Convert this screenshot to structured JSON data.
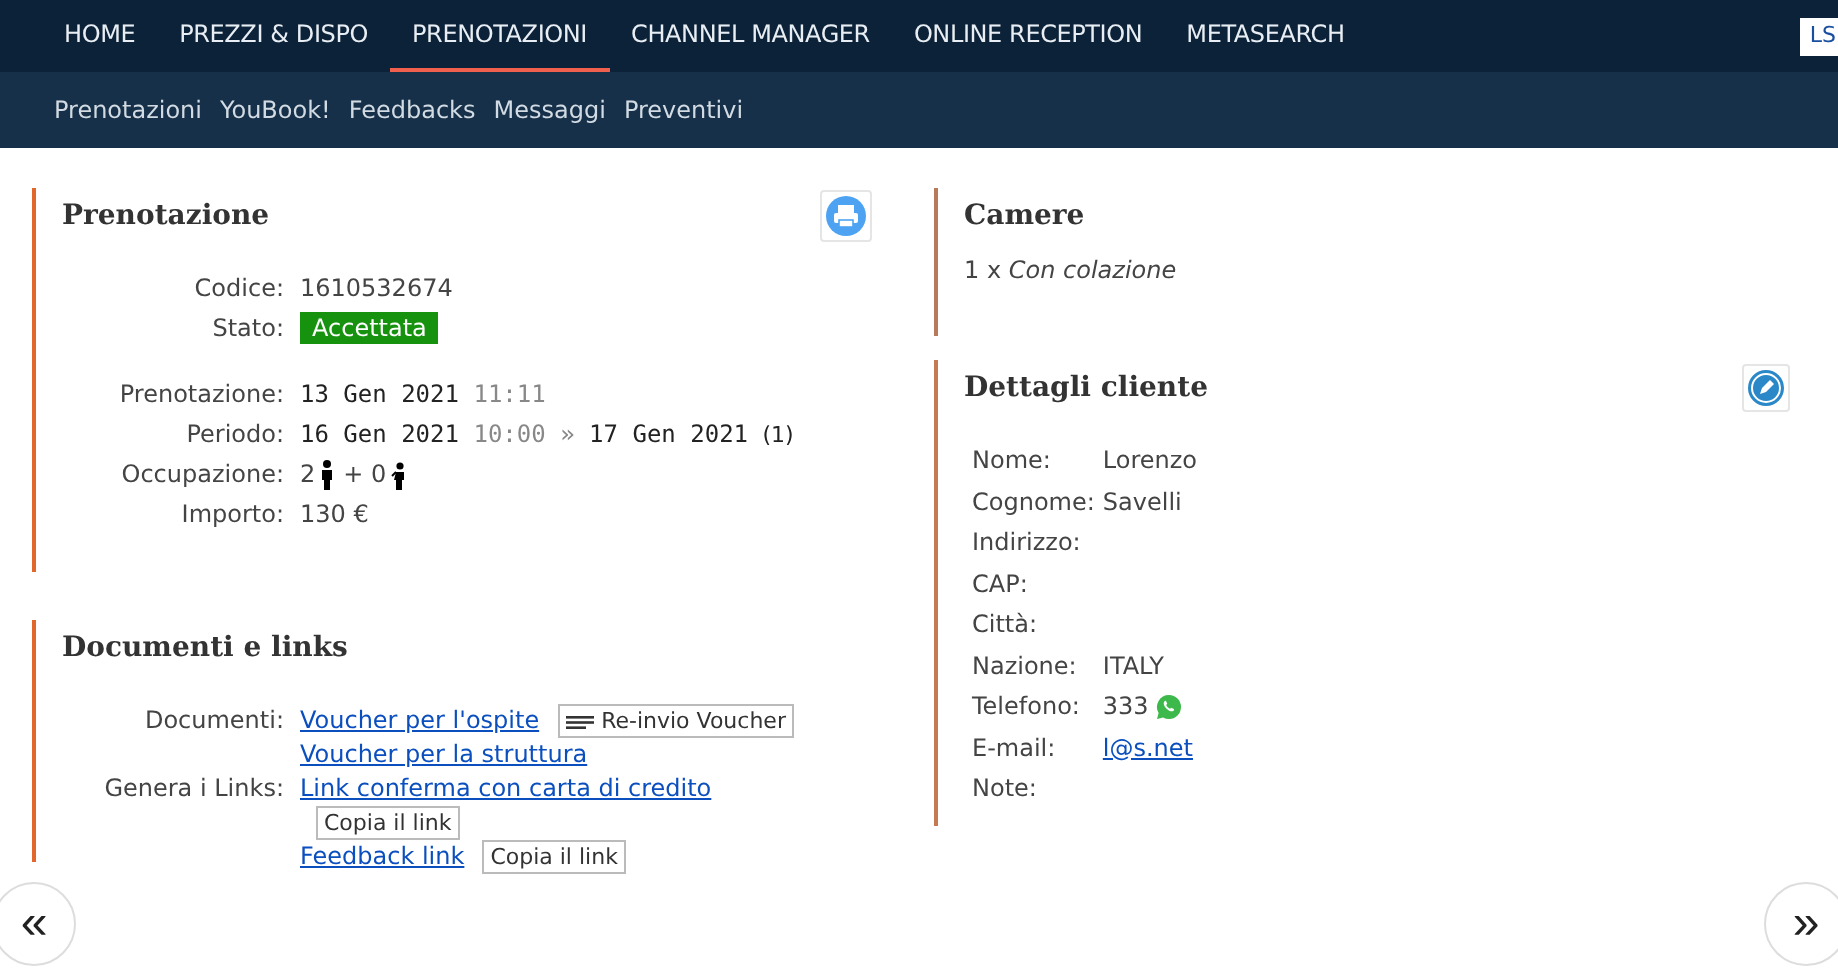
{
  "nav": [
    {
      "label": "HOME",
      "selected": false
    },
    {
      "label": "PREZZI & DISPO",
      "selected": false
    },
    {
      "label": "PRENOTAZIONI",
      "selected": true
    },
    {
      "label": "CHANNEL MANAGER",
      "selected": false
    },
    {
      "label": "ONLINE RECEPTION",
      "selected": false
    },
    {
      "label": "METASEARCH",
      "selected": false
    }
  ],
  "user_badge": "LS",
  "subnav": [
    "Prenotazioni",
    "YouBook!",
    "Feedbacks",
    "Messaggi",
    "Preventivi"
  ],
  "booking": {
    "title": "Prenotazione",
    "code_label": "Codice:",
    "code": "1610532674",
    "status_label": "Stato:",
    "status": "Accettata",
    "created_label": "Prenotazione:",
    "created_date": "13 Gen 2021",
    "created_time": "11:11",
    "period_label": "Periodo:",
    "period_from": "16 Gen 2021",
    "period_time": "10:00",
    "period_sep": "»",
    "period_to": "17 Gen 2021",
    "nights": "(1)",
    "occupancy_label": "Occupazione:",
    "adults": "2",
    "children": "+ 0",
    "amount_label": "Importo:",
    "amount": "130 €"
  },
  "documents": {
    "title": "Documenti e links",
    "docs_label": "Documenti:",
    "guest_voucher": "Voucher per l'ospite",
    "resend_button": "Re-invio Voucher",
    "property_voucher": "Voucher per la struttura",
    "links_label": "Genera i Links:",
    "card_link": "Link conferma con carta di credito",
    "copy_button_1": "Copia il link",
    "feedback_link": "Feedback link",
    "copy_button_2": "Copia il link"
  },
  "rooms": {
    "title": "Camere",
    "count": "1 x",
    "name": "Con colazione"
  },
  "customer": {
    "title": "Dettagli cliente",
    "fields": [
      {
        "label": "Nome:",
        "value": "Lorenzo",
        "kind": "text"
      },
      {
        "label": "Cognome:",
        "value": "Savelli",
        "kind": "text"
      },
      {
        "label": "Indirizzo:",
        "kind": "text"
      },
      {
        "label": "CAP:",
        "kind": "text"
      },
      {
        "label": "Città:",
        "kind": "text"
      },
      {
        "label": "Nazione:",
        "value": "ITALY",
        "kind": "text"
      },
      {
        "label": "Telefono:",
        "value": "333",
        "kind": "phone"
      },
      {
        "label": "E-mail:",
        "value": "l@s.net",
        "kind": "email"
      },
      {
        "label": "Note:",
        "kind": "text"
      }
    ]
  },
  "pager": {
    "prev": "«",
    "next": "»"
  }
}
